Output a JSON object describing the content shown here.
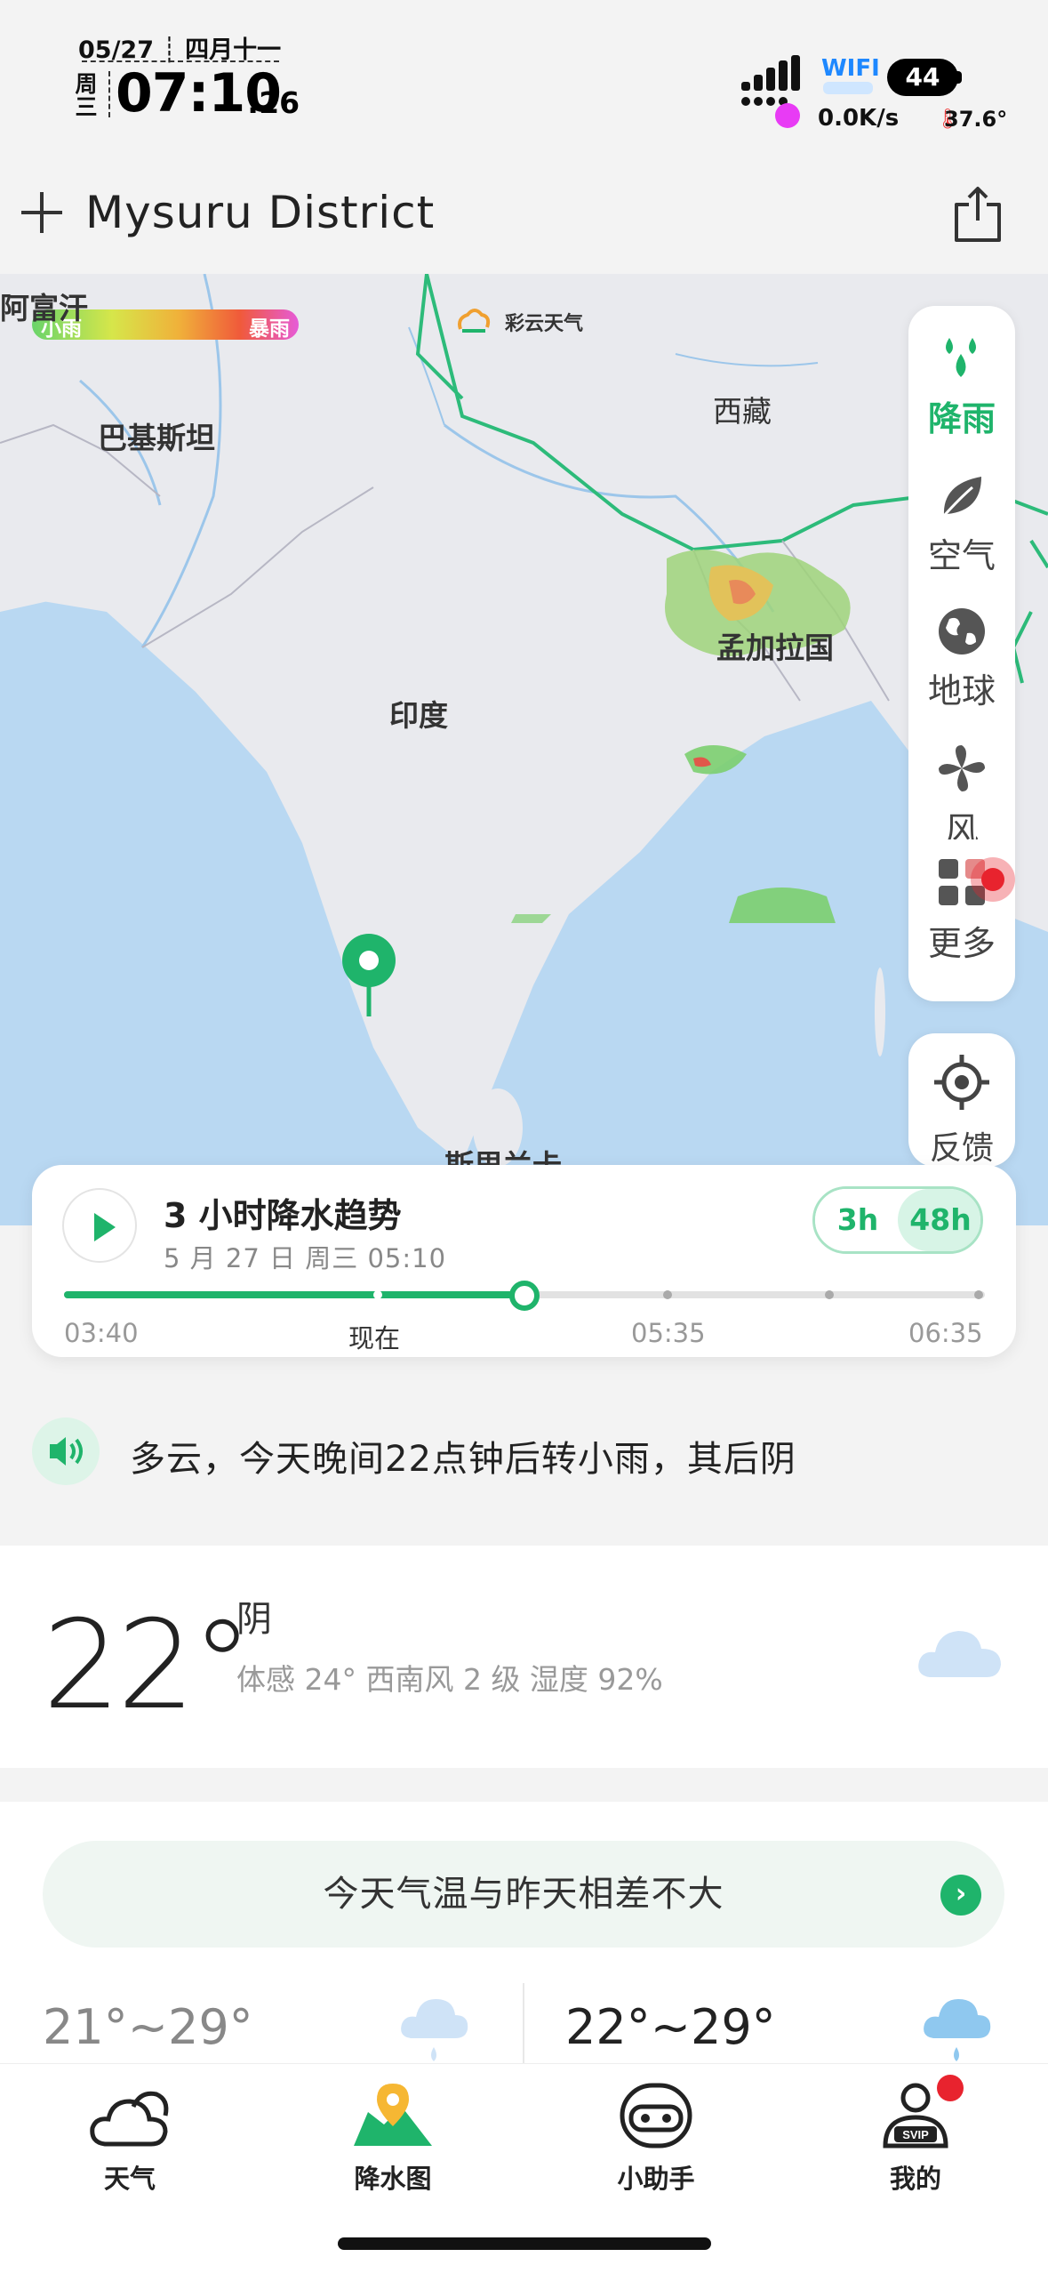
{
  "status_bar": {
    "date": "05/27",
    "lunar": "四月十一",
    "weekday": "周三",
    "time": "07:10",
    "seconds": ":26",
    "wifi": "WIFI",
    "battery": "44",
    "net_speed": "0.0K/s",
    "temperature": "37.6°"
  },
  "header": {
    "location": "Mysuru District"
  },
  "map": {
    "legend_low": "小雨",
    "legend_high": "暴雨",
    "brand": "彩云天气",
    "labels": {
      "afghanistan": "阿富汗",
      "pakistan": "巴基斯坦",
      "tibet": "西藏",
      "bangladesh": "孟加拉国",
      "india": "印度",
      "srilanka": "斯里兰卡"
    }
  },
  "side_panel": {
    "items": [
      {
        "label": "降雨",
        "icon": "rain-drops-icon",
        "active": true
      },
      {
        "label": "空气",
        "icon": "leaf-icon",
        "active": false
      },
      {
        "label": "地球",
        "icon": "globe-icon",
        "active": false
      },
      {
        "label": "风",
        "icon": "fan-icon",
        "active": false
      },
      {
        "label": "更多",
        "icon": "grid-icon",
        "active": false
      }
    ],
    "feedback_label": "反馈"
  },
  "trend": {
    "title": "3 小时降水趋势",
    "subtitle": "5 月 27 日 周三 05:10",
    "toggle_3h": "3h",
    "toggle_48h": "48h",
    "ticks": [
      "03:40",
      "现在",
      "05:35",
      "06:35"
    ],
    "progress": 0.5
  },
  "summary": "多云，今天晚间22点钟后转小雨，其后阴",
  "current": {
    "temperature": "22°",
    "condition": "阴",
    "details": "体感 24°  西南风 2 级  湿度 92%"
  },
  "compare": {
    "text": "今天气温与昨天相差不大"
  },
  "forecast": [
    {
      "range": "21°~29°"
    },
    {
      "range": "22°~29°"
    }
  ],
  "nav": {
    "items": [
      {
        "label": "天气"
      },
      {
        "label": "降水图"
      },
      {
        "label": "小助手"
      },
      {
        "label": "我的"
      }
    ]
  },
  "colors": {
    "accent": "#1fb46b",
    "sea": "#b9d8f2",
    "land": "#e9eaee"
  }
}
